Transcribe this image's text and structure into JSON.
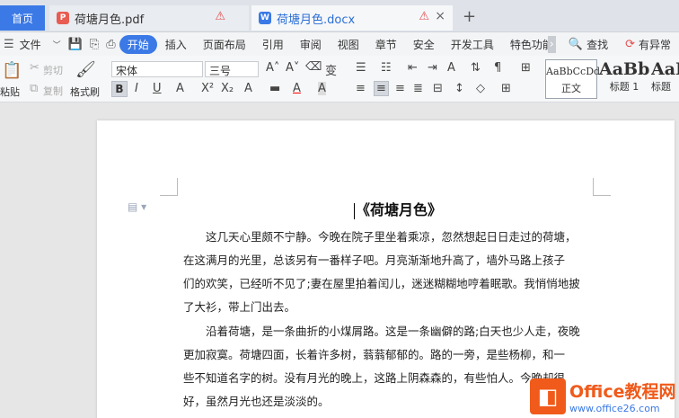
{
  "tabs": {
    "home": "首页",
    "pdf": "荷塘月色.pdf",
    "docx": "荷塘月色.docx",
    "pdf_icon": "P",
    "docx_icon": "W",
    "warn_icon": "⚠",
    "close_icon": "×",
    "new_tab_icon": "+"
  },
  "menubar": {
    "file": "文件",
    "items": [
      "开始",
      "插入",
      "页面布局",
      "引用",
      "审阅",
      "视图",
      "章节",
      "安全",
      "开发工具",
      "特色功能"
    ],
    "active": "开始",
    "search": "查找",
    "exception": "有异常"
  },
  "ribbon": {
    "paste": "粘贴",
    "cut": "剪切",
    "copy": "复制",
    "format_painter": "格式刷",
    "font_name": "宋体",
    "font_size": "三号",
    "bold": "B",
    "italic": "I",
    "underline": "U",
    "styles": [
      {
        "sample": "AaBbCcDd",
        "label": "正文"
      },
      {
        "sample": "AaBb",
        "label": "标题 1"
      },
      {
        "sample": "AaB",
        "label": "标题"
      }
    ]
  },
  "document": {
    "title": "《荷塘月色》",
    "lines": [
      "这几天心里颇不宁静。今晚在院子里坐着乘凉，忽然想起日日走过的荷塘，",
      "在这满月的光里，总该另有一番样子吧。月亮渐渐地升高了，墙外马路上孩子",
      "们的欢笑，已经听不见了;妻在屋里拍着闰儿，迷迷糊糊地哼着眠歌。我悄悄地披",
      "了大衫，带上门出去。",
      "沿着荷塘，是一条曲折的小煤屑路。这是一条幽僻的路;白天也少人走，夜晚",
      "更加寂寞。荷塘四面，长着许多树，蓊蓊郁郁的。路的一旁，是些杨柳，和一",
      "些不知道名字的树。没有月光的晚上，这路上阴森森的，有些怕人。今晚却很",
      "好，虽然月光也还是淡淡的。"
    ]
  },
  "watermark": {
    "main": "Office教程网",
    "sub": "www.office26.com"
  },
  "colors": {
    "accent": "#3a79e6",
    "warning": "#e24d4d",
    "logo": "#f05a1a"
  }
}
